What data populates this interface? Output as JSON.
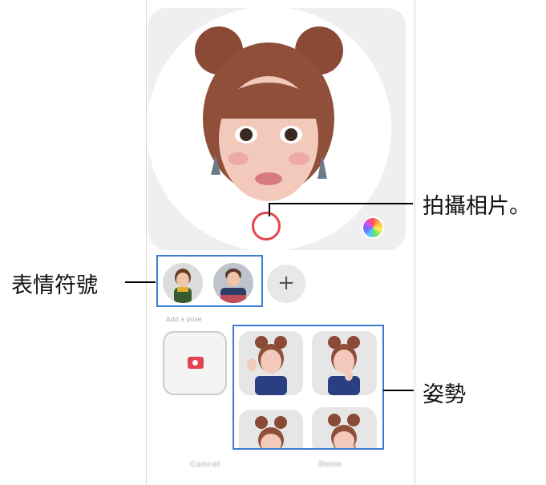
{
  "callouts": {
    "take_photo": "拍攝相片。",
    "emojis": "表情符號",
    "poses": "姿勢"
  },
  "ui": {
    "add_pose_label": "Add a pose",
    "add_button_symbol": "+",
    "cancel_label": "Cancel",
    "done_label": "Done"
  },
  "colors": {
    "shutter_ring": "#e3474b",
    "highlight_box": "#3b7bd3",
    "camera_icon": "#e24450"
  }
}
